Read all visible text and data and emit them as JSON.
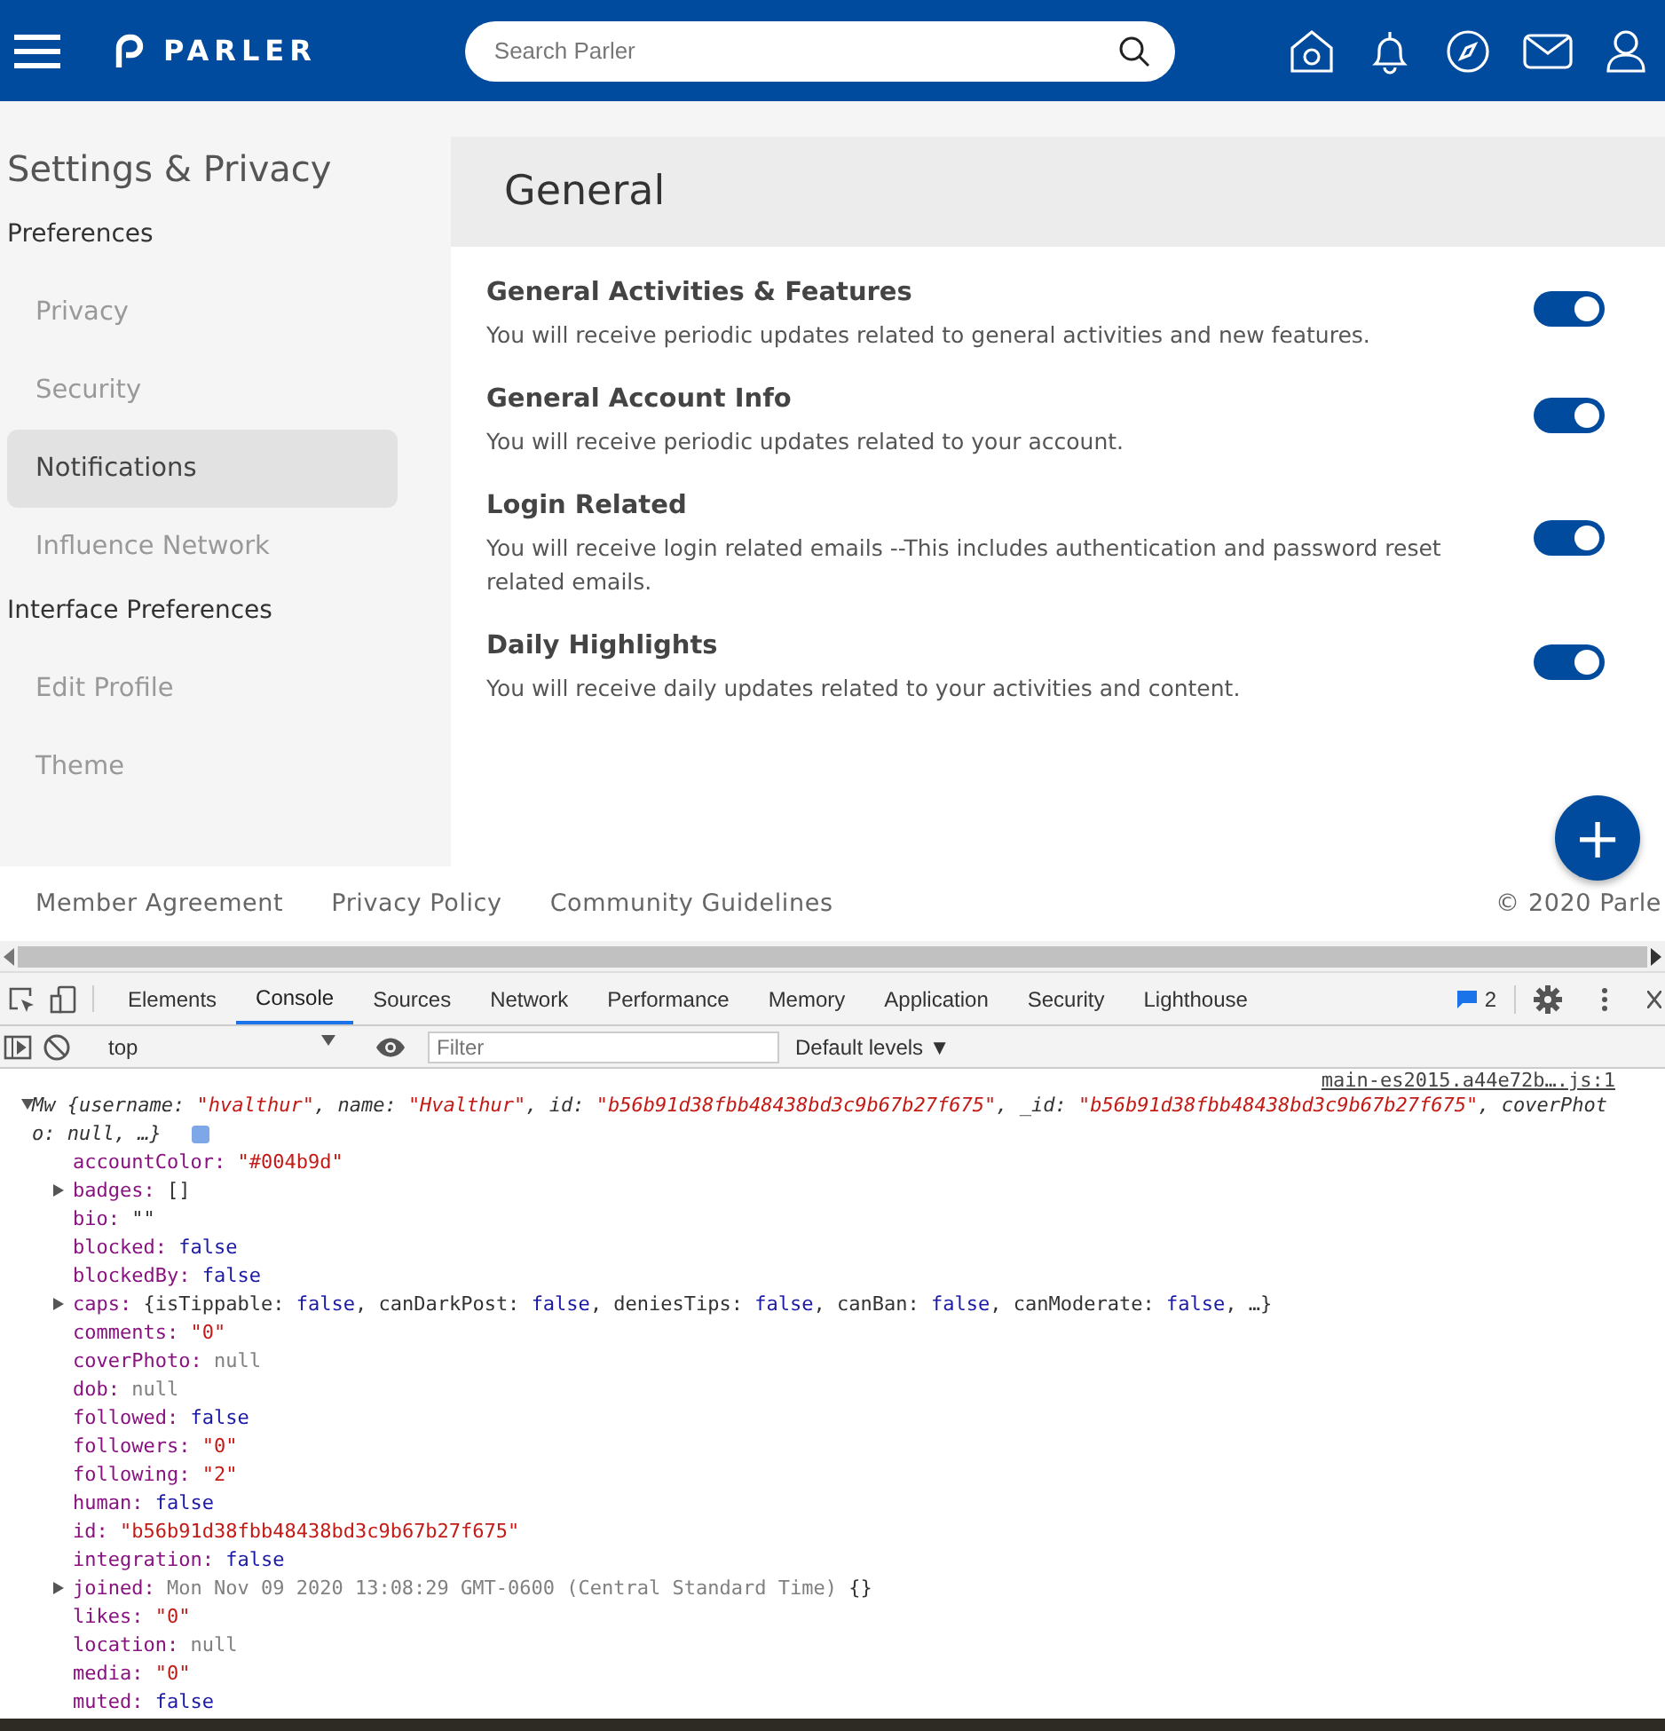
{
  "topbar": {
    "logo": "PARLER",
    "search": {
      "placeholder": "Search Parler"
    }
  },
  "sidebar": {
    "title": "Settings & Privacy",
    "sections": [
      {
        "label": "Preferences",
        "items": [
          {
            "label": "Privacy",
            "selected": false
          },
          {
            "label": "Security",
            "selected": false
          },
          {
            "label": "Notifications",
            "selected": true
          },
          {
            "label": "Influence Network",
            "selected": false
          }
        ]
      },
      {
        "label": "Interface Preferences",
        "items": [
          {
            "label": "Edit Profile",
            "selected": false
          },
          {
            "label": "Theme",
            "selected": false
          }
        ]
      }
    ]
  },
  "panel": {
    "title": "General",
    "settings": [
      {
        "title": "General Activities & Features",
        "description": "You will receive periodic updates related to general activities and new features.",
        "on": true
      },
      {
        "title": "General Account Info",
        "description": "You will receive periodic updates related to your account.",
        "on": true
      },
      {
        "title": "Login Related",
        "description": "You will receive login related emails --This includes authentication and password reset related emails.",
        "on": true
      },
      {
        "title": "Daily Highlights",
        "description": "You will receive daily updates related to your activities and content.",
        "on": true
      }
    ]
  },
  "fab": {
    "label": "+"
  },
  "footer": {
    "links": [
      "Member Agreement",
      "Privacy Policy",
      "Community Guidelines"
    ],
    "copyright": "© 2020 Parle"
  },
  "devtools": {
    "tabs": [
      {
        "label": "Elements",
        "selected": false
      },
      {
        "label": "Console",
        "selected": true
      },
      {
        "label": "Sources",
        "selected": false
      },
      {
        "label": "Network",
        "selected": false
      },
      {
        "label": "Performance",
        "selected": false
      },
      {
        "label": "Memory",
        "selected": false
      },
      {
        "label": "Application",
        "selected": false
      },
      {
        "label": "Security",
        "selected": false
      },
      {
        "label": "Lighthouse",
        "selected": false
      }
    ],
    "message_count": "2",
    "context": "top",
    "filter": {
      "placeholder": "Filter"
    },
    "levels": "Default levels ▼",
    "source": "main-es2015.a44e72b….js:1",
    "summary": [
      {
        "t": "Mw {username: ",
        "kind": "plain"
      },
      {
        "t": "\"hvalthur\"",
        "kind": "string"
      },
      {
        "t": ", name: ",
        "kind": "plain"
      },
      {
        "t": "\"Hvalthur\"",
        "kind": "string"
      },
      {
        "t": ", id: ",
        "kind": "plain"
      },
      {
        "t": "\"b56b91d38fbb48438bd3c9b67b27f675\"",
        "kind": "string"
      },
      {
        "t": ", _id: ",
        "kind": "plain"
      },
      {
        "t": "\"b56b91d38fbb48438bd3c9b67b27f675\"",
        "kind": "string"
      },
      {
        "t": ", coverPhoto: null, …}",
        "kind": "plain"
      }
    ],
    "lines": [
      {
        "key": "accountColor:",
        "expandable": false,
        "value": [
          {
            "t": "\"#004b9d\"",
            "kind": "string"
          }
        ]
      },
      {
        "key": "badges:",
        "expandable": true,
        "value": [
          {
            "t": "[]",
            "kind": "plain"
          }
        ]
      },
      {
        "key": "bio:",
        "expandable": false,
        "value": [
          {
            "t": "\"\"",
            "kind": "plain"
          }
        ]
      },
      {
        "key": "blocked:",
        "expandable": false,
        "value": [
          {
            "t": "false",
            "kind": "boolean"
          }
        ]
      },
      {
        "key": "blockedBy:",
        "expandable": false,
        "value": [
          {
            "t": "false",
            "kind": "boolean"
          }
        ]
      },
      {
        "key": "caps:",
        "expandable": true,
        "value": [
          {
            "t": "{isTippable: ",
            "kind": "plain"
          },
          {
            "t": "false",
            "kind": "boolean"
          },
          {
            "t": ", canDarkPost: ",
            "kind": "plain"
          },
          {
            "t": "false",
            "kind": "boolean"
          },
          {
            "t": ", deniesTips: ",
            "kind": "plain"
          },
          {
            "t": "false",
            "kind": "boolean"
          },
          {
            "t": ", canBan: ",
            "kind": "plain"
          },
          {
            "t": "false",
            "kind": "boolean"
          },
          {
            "t": ", canModerate: ",
            "kind": "plain"
          },
          {
            "t": "false",
            "kind": "boolean"
          },
          {
            "t": ", …}",
            "kind": "plain"
          }
        ]
      },
      {
        "key": "comments:",
        "expandable": false,
        "value": [
          {
            "t": "\"0\"",
            "kind": "string"
          }
        ]
      },
      {
        "key": "coverPhoto:",
        "expandable": false,
        "value": [
          {
            "t": "null",
            "kind": "null"
          }
        ]
      },
      {
        "key": "dob:",
        "expandable": false,
        "value": [
          {
            "t": "null",
            "kind": "null"
          }
        ]
      },
      {
        "key": "followed:",
        "expandable": false,
        "value": [
          {
            "t": "false",
            "kind": "boolean"
          }
        ]
      },
      {
        "key": "followers:",
        "expandable": false,
        "value": [
          {
            "t": "\"0\"",
            "kind": "string"
          }
        ]
      },
      {
        "key": "following:",
        "expandable": false,
        "value": [
          {
            "t": "\"2\"",
            "kind": "string"
          }
        ]
      },
      {
        "key": "human:",
        "expandable": false,
        "value": [
          {
            "t": "false",
            "kind": "boolean"
          }
        ]
      },
      {
        "key": "id:",
        "expandable": false,
        "value": [
          {
            "t": "\"b56b91d38fbb48438bd3c9b67b27f675\"",
            "kind": "string"
          }
        ]
      },
      {
        "key": "integration:",
        "expandable": false,
        "value": [
          {
            "t": "false",
            "kind": "boolean"
          }
        ]
      },
      {
        "key": "joined:",
        "expandable": true,
        "value": [
          {
            "t": "Mon Nov 09 2020 13:08:29 GMT-0600 (Central Standard Time)",
            "kind": "null"
          },
          {
            "t": " {}",
            "kind": "plain"
          }
        ]
      },
      {
        "key": "likes:",
        "expandable": false,
        "value": [
          {
            "t": "\"0\"",
            "kind": "string"
          }
        ]
      },
      {
        "key": "location:",
        "expandable": false,
        "value": [
          {
            "t": "null",
            "kind": "null"
          }
        ]
      },
      {
        "key": "media:",
        "expandable": false,
        "value": [
          {
            "t": "\"0\"",
            "kind": "string"
          }
        ]
      },
      {
        "key": "muted:",
        "expandable": false,
        "value": [
          {
            "t": "false",
            "kind": "boolean"
          }
        ]
      }
    ]
  }
}
